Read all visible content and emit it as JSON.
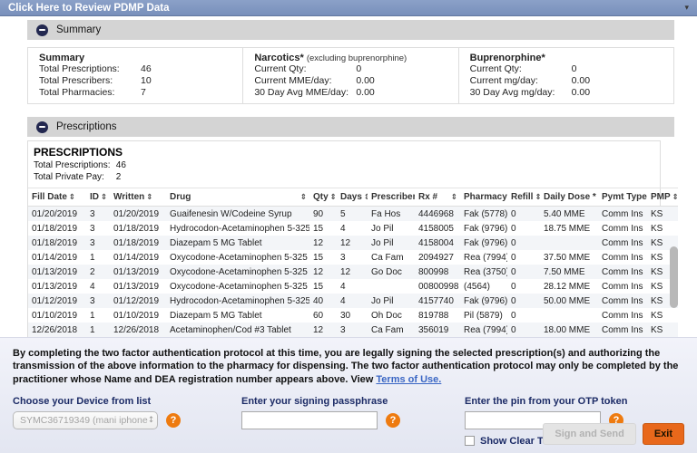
{
  "header": {
    "title": "Click Here to Review PDMP Data",
    "caret_icon": "▾"
  },
  "summary_section": {
    "label": "Summary",
    "boxes": [
      {
        "title": "Summary",
        "subtitle": "",
        "rows": [
          {
            "label": "Total Prescriptions:",
            "value": "46"
          },
          {
            "label": "Total Prescribers:",
            "value": "10"
          },
          {
            "label": "Total Pharmacies:",
            "value": "7"
          }
        ]
      },
      {
        "title": "Narcotics*",
        "subtitle": "(excluding buprenorphine)",
        "rows": [
          {
            "label": "Current Qty:",
            "value": "0"
          },
          {
            "label": "Current MME/day:",
            "value": "0.00"
          },
          {
            "label": "30 Day Avg MME/day:",
            "value": "0.00"
          }
        ]
      },
      {
        "title": "Buprenorphine*",
        "subtitle": "",
        "rows": [
          {
            "label": "Current Qty:",
            "value": "0"
          },
          {
            "label": "Current mg/day:",
            "value": "0.00"
          },
          {
            "label": "30 Day Avg mg/day:",
            "value": "0.00"
          }
        ]
      }
    ]
  },
  "prescriptions_section": {
    "label": "Prescriptions",
    "heading": "PRESCRIPTIONS",
    "totals": [
      {
        "label": "Total Prescriptions:",
        "value": "46"
      },
      {
        "label": "Total Private Pay:",
        "value": "2"
      }
    ],
    "sort_icon": "⇕",
    "columns": [
      "Fill Date",
      "ID",
      "Written",
      "Drug",
      "Qty",
      "Days",
      "Prescriber",
      "Rx #",
      "Pharmacy",
      "Refill",
      "Daily Dose *",
      "Pymt Type",
      "PMP"
    ],
    "rows": [
      [
        "01/20/2019",
        "3",
        "01/20/2019",
        "Guaifenesin W/Codeine Syrup",
        "90",
        "5",
        "Fa Hos",
        "4446968",
        "Fak (5778)",
        "0",
        "5.40 MME",
        "Comm Ins",
        "KS"
      ],
      [
        "01/18/2019",
        "3",
        "01/18/2019",
        "Hydrocodon-Acetaminophen 5-325",
        "15",
        "4",
        "Jo Pil",
        "4158005",
        "Fak (9796)",
        "0",
        "18.75 MME",
        "Comm Ins",
        "KS"
      ],
      [
        "01/18/2019",
        "3",
        "01/18/2019",
        "Diazepam 5 MG Tablet",
        "12",
        "12",
        "Jo Pil",
        "4158004",
        "Fak (9796)",
        "0",
        "",
        "Comm Ins",
        "KS"
      ],
      [
        "01/14/2019",
        "1",
        "01/14/2019",
        "Oxycodone-Acetaminophen 5-325",
        "15",
        "3",
        "Ca Fam",
        "2094927",
        "Rea (7994)",
        "0",
        "37.50 MME",
        "Comm Ins",
        "KS"
      ],
      [
        "01/13/2019",
        "2",
        "01/13/2019",
        "Oxycodone-Acetaminophen 5-325",
        "12",
        "12",
        "Go Doc",
        "800998",
        "Rea (3750)",
        "0",
        "7.50 MME",
        "Comm Ins",
        "KS"
      ],
      [
        "01/13/2019",
        "4",
        "01/13/2019",
        "Oxycodone-Acetaminophen 5-325",
        "15",
        "4",
        "",
        "00800998",
        "(4564)",
        "0",
        "28.12 MME",
        "Comm Ins",
        "KS"
      ],
      [
        "01/12/2019",
        "3",
        "01/12/2019",
        "Hydrocodon-Acetaminophen 5-325",
        "40",
        "4",
        "Jo Pil",
        "4157740",
        "Fak (9796)",
        "0",
        "50.00 MME",
        "Comm Ins",
        "KS"
      ],
      [
        "01/10/2019",
        "1",
        "01/10/2019",
        "Diazepam 5 MG Tablet",
        "60",
        "30",
        "Oh Doc",
        "819788",
        "Pil (5879)",
        "0",
        "",
        "Comm Ins",
        "KS"
      ],
      [
        "12/26/2018",
        "1",
        "12/26/2018",
        "Acetaminophen/Cod #3 Tablet",
        "12",
        "3",
        "Ca Fam",
        "356019",
        "Rea (7994)",
        "0",
        "18.00 MME",
        "Comm Ins",
        "KS"
      ]
    ]
  },
  "signing_panel": {
    "disclaimer": "By completing the two factor authentication protocol at this time, you are legally signing the selected prescription(s) and authorizing the transmission of the above information to the pharmacy for dispensing. The two factor authentication protocol may only be completed by the practitioner whose Name and DEA registration number appears above. View",
    "terms_link": "Terms of Use.",
    "device": {
      "label": "Choose your Device from list",
      "value": "SYMC36719349 (mani iphone",
      "stepper_icon": "↕",
      "help_icon": "?"
    },
    "passphrase": {
      "label": "Enter your signing passphrase",
      "value": "",
      "help_icon": "?"
    },
    "otp": {
      "label": "Enter the pin from your OTP token",
      "value": "",
      "help_icon": "?",
      "show_clear_text": "Show Clear Text"
    },
    "buttons": {
      "sign": "Sign and Send",
      "exit": "Exit"
    }
  },
  "colors": {
    "header_bar": "#7890bb",
    "section_bar": "#d4d4d4",
    "accent_orange": "#ee7b10",
    "link_blue": "#3a66c4",
    "label_navy": "#1c2b66"
  }
}
